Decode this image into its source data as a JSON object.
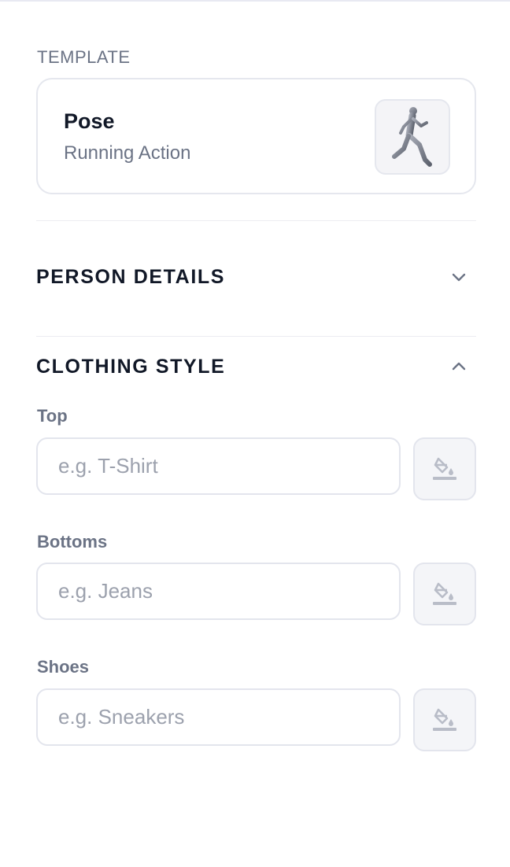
{
  "template": {
    "section_label": "TEMPLATE",
    "title": "Pose",
    "subtitle": "Running Action",
    "thumbnail_icon": "running-figure-icon"
  },
  "person_details": {
    "title": "PERSON DETAILS",
    "expanded": false
  },
  "clothing_style": {
    "title": "CLOTHING STYLE",
    "expanded": true,
    "fields": [
      {
        "label": "Top",
        "placeholder": "e.g. T-Shirt",
        "value": "",
        "color_icon": "paint-bucket-icon"
      },
      {
        "label": "Bottoms",
        "placeholder": "e.g. Jeans",
        "value": "",
        "color_icon": "paint-bucket-icon"
      },
      {
        "label": "Shoes",
        "placeholder": "e.g. Sneakers",
        "value": "",
        "color_icon": "paint-bucket-icon"
      }
    ]
  },
  "colors": {
    "heading": "#111827",
    "muted": "#6b7385",
    "placeholder": "#9ca1ad",
    "border": "#e3e5ed",
    "icon": "#b9bdc8"
  }
}
